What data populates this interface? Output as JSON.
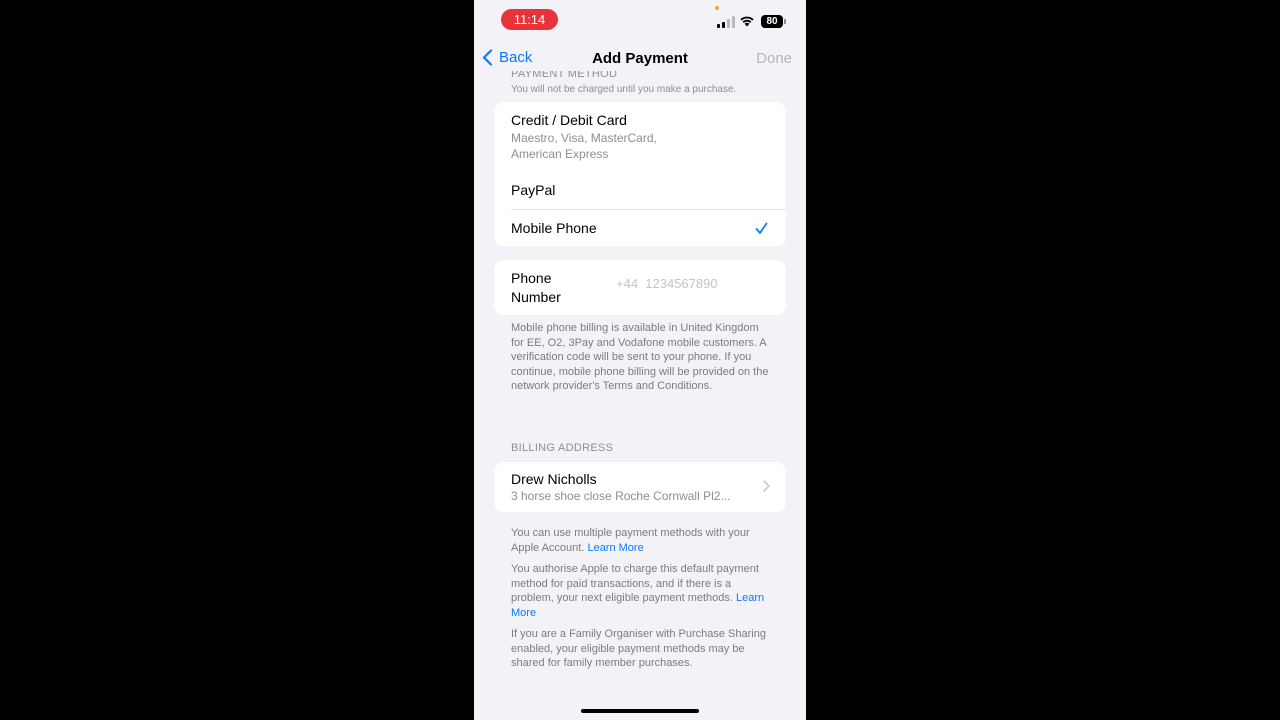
{
  "status_bar": {
    "time": "11:14",
    "battery": "80"
  },
  "nav": {
    "back_label": "Back",
    "title": "Add Payment",
    "done_label": "Done"
  },
  "payment_method": {
    "header": "PAYMENT METHOD",
    "note": "You will not be charged until you make a purchase.",
    "options": [
      {
        "title": "Credit / Debit Card",
        "subtitle_line1": "Maestro, Visa, MasterCard,",
        "subtitle_line2": "American Express"
      },
      {
        "title": "PayPal"
      },
      {
        "title": "Mobile Phone",
        "selected": true
      }
    ]
  },
  "phone_number": {
    "label_line1": "Phone",
    "label_line2": "Number",
    "placeholder": "+44  1234567890"
  },
  "mobile_info": "Mobile phone billing is available in United Kingdom for EE, O2, 3Pay and Vodafone mobile customers. A verification code will be sent to your phone. If you continue, mobile phone billing will be provided on the network provider's Terms and Conditions.",
  "billing": {
    "header": "BILLING ADDRESS",
    "name": "Drew Nicholls",
    "address": "3 horse shoe close Roche Cornwall Pl2..."
  },
  "footer": {
    "multiple_text": "You can use multiple payment methods with your Apple Account.",
    "learn_more_1": "Learn More",
    "authorise_text": "You authorise Apple to charge this default payment method for paid transactions, and if there is a problem, your next eligible payment methods.",
    "learn_more_2": "Learn More",
    "family_text": "If you are a Family Organiser with Purchase Sharing enabled, your eligible payment methods may be shared for family member purchases."
  },
  "colors": {
    "accent": "#0a7aff",
    "time_pill": "#e8333a",
    "background": "#f2f2f7"
  }
}
